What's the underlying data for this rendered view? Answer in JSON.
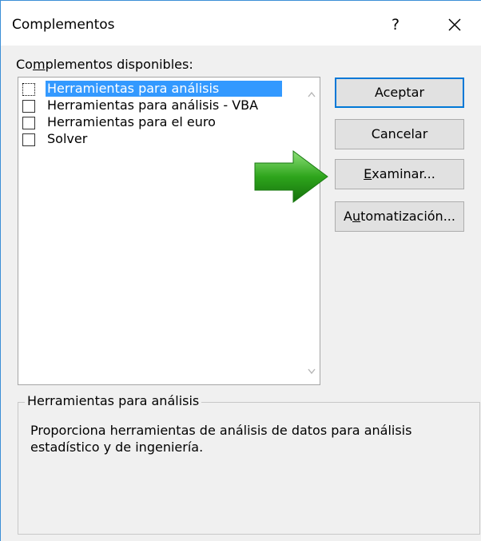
{
  "window": {
    "title": "Complementos",
    "help_label": "?"
  },
  "addins": {
    "label_prefix": "Co",
    "label_accel": "m",
    "label_suffix": "plementos disponibles:",
    "items": [
      {
        "label": "Herramientas para análisis",
        "checked": false,
        "selected": true
      },
      {
        "label": "Herramientas para análisis - VBA",
        "checked": false,
        "selected": false
      },
      {
        "label": "Herramientas para el euro",
        "checked": false,
        "selected": false
      },
      {
        "label": "Solver",
        "checked": false,
        "selected": false
      }
    ]
  },
  "buttons": {
    "aceptar": "Aceptar",
    "cancelar": "Cancelar",
    "examinar_accel": "E",
    "examinar_rest": "xaminar...",
    "automatizacion_first": "A",
    "automatizacion_accel": "u",
    "automatizacion_rest": "tomatización..."
  },
  "description": {
    "title": "Herramientas para análisis",
    "text": "Proporciona herramientas de análisis de datos para análisis estadístico y de ingeniería."
  },
  "colors": {
    "selection": "#3399ff",
    "default_button_border": "#0078d7",
    "arrow": "#2e9e1e"
  }
}
